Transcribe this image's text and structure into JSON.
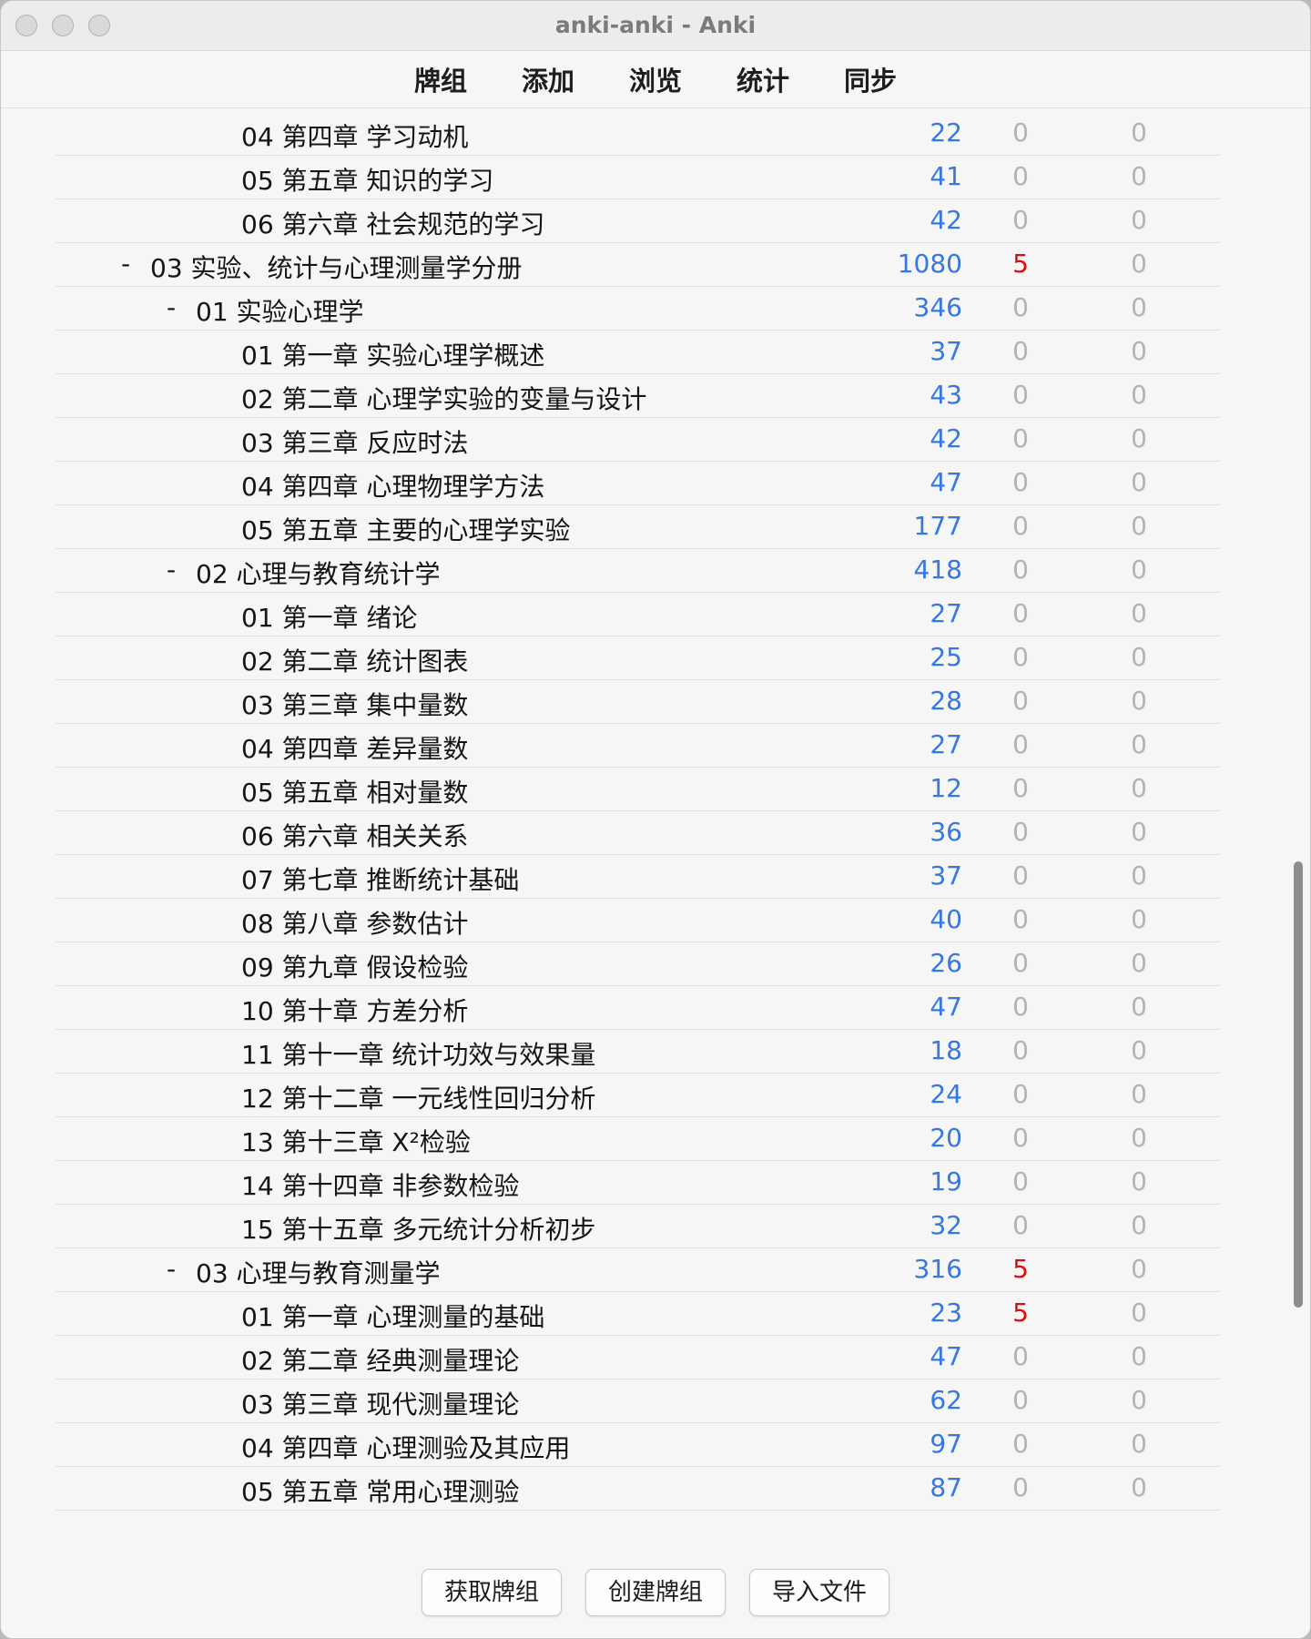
{
  "window": {
    "title": "anki-anki - Anki"
  },
  "toolbar": {
    "tabs": [
      "牌组",
      "添加",
      "浏览",
      "统计",
      "同步"
    ]
  },
  "decks": [
    {
      "level": 3,
      "collapse": "",
      "name": "04 第四章 学习动机",
      "new": "22",
      "learn": "0",
      "due": "0"
    },
    {
      "level": 3,
      "collapse": "",
      "name": "05 第五章 知识的学习",
      "new": "41",
      "learn": "0",
      "due": "0"
    },
    {
      "level": 3,
      "collapse": "",
      "name": "06 第六章 社会规范的学习",
      "new": "42",
      "learn": "0",
      "due": "0"
    },
    {
      "level": 1,
      "collapse": "-",
      "name": "03 实验、统计与心理测量学分册",
      "new": "1080",
      "learn": "5",
      "due": "0"
    },
    {
      "level": 2,
      "collapse": "-",
      "name": "01 实验心理学",
      "new": "346",
      "learn": "0",
      "due": "0"
    },
    {
      "level": 3,
      "collapse": "",
      "name": "01 第一章 实验心理学概述",
      "new": "37",
      "learn": "0",
      "due": "0"
    },
    {
      "level": 3,
      "collapse": "",
      "name": "02 第二章 心理学实验的变量与设计",
      "new": "43",
      "learn": "0",
      "due": "0"
    },
    {
      "level": 3,
      "collapse": "",
      "name": "03 第三章 反应时法",
      "new": "42",
      "learn": "0",
      "due": "0"
    },
    {
      "level": 3,
      "collapse": "",
      "name": "04 第四章 心理物理学方法",
      "new": "47",
      "learn": "0",
      "due": "0"
    },
    {
      "level": 3,
      "collapse": "",
      "name": "05 第五章 主要的心理学实验",
      "new": "177",
      "learn": "0",
      "due": "0"
    },
    {
      "level": 2,
      "collapse": "-",
      "name": "02 心理与教育统计学",
      "new": "418",
      "learn": "0",
      "due": "0"
    },
    {
      "level": 3,
      "collapse": "",
      "name": "01 第一章 绪论",
      "new": "27",
      "learn": "0",
      "due": "0"
    },
    {
      "level": 3,
      "collapse": "",
      "name": "02 第二章 统计图表",
      "new": "25",
      "learn": "0",
      "due": "0"
    },
    {
      "level": 3,
      "collapse": "",
      "name": "03 第三章 集中量数",
      "new": "28",
      "learn": "0",
      "due": "0"
    },
    {
      "level": 3,
      "collapse": "",
      "name": "04 第四章 差异量数",
      "new": "27",
      "learn": "0",
      "due": "0"
    },
    {
      "level": 3,
      "collapse": "",
      "name": "05 第五章 相对量数",
      "new": "12",
      "learn": "0",
      "due": "0"
    },
    {
      "level": 3,
      "collapse": "",
      "name": "06 第六章 相关关系",
      "new": "36",
      "learn": "0",
      "due": "0"
    },
    {
      "level": 3,
      "collapse": "",
      "name": "07 第七章 推断统计基础",
      "new": "37",
      "learn": "0",
      "due": "0"
    },
    {
      "level": 3,
      "collapse": "",
      "name": "08 第八章 参数估计",
      "new": "40",
      "learn": "0",
      "due": "0"
    },
    {
      "level": 3,
      "collapse": "",
      "name": "09 第九章 假设检验",
      "new": "26",
      "learn": "0",
      "due": "0"
    },
    {
      "level": 3,
      "collapse": "",
      "name": "10 第十章 方差分析",
      "new": "47",
      "learn": "0",
      "due": "0"
    },
    {
      "level": 3,
      "collapse": "",
      "name": "11 第十一章 统计功效与效果量",
      "new": "18",
      "learn": "0",
      "due": "0"
    },
    {
      "level": 3,
      "collapse": "",
      "name": "12 第十二章 一元线性回归分析",
      "new": "24",
      "learn": "0",
      "due": "0"
    },
    {
      "level": 3,
      "collapse": "",
      "name": "13 第十三章 X²检验",
      "new": "20",
      "learn": "0",
      "due": "0"
    },
    {
      "level": 3,
      "collapse": "",
      "name": "14 第十四章 非参数检验",
      "new": "19",
      "learn": "0",
      "due": "0"
    },
    {
      "level": 3,
      "collapse": "",
      "name": "15 第十五章 多元统计分析初步",
      "new": "32",
      "learn": "0",
      "due": "0"
    },
    {
      "level": 2,
      "collapse": "-",
      "name": "03 心理与教育测量学",
      "new": "316",
      "learn": "5",
      "due": "0"
    },
    {
      "level": 3,
      "collapse": "",
      "name": "01 第一章 心理测量的基础",
      "new": "23",
      "learn": "5",
      "due": "0"
    },
    {
      "level": 3,
      "collapse": "",
      "name": "02 第二章 经典测量理论",
      "new": "47",
      "learn": "0",
      "due": "0"
    },
    {
      "level": 3,
      "collapse": "",
      "name": "03 第三章 现代测量理论",
      "new": "62",
      "learn": "0",
      "due": "0"
    },
    {
      "level": 3,
      "collapse": "",
      "name": "04 第四章 心理测验及其应用",
      "new": "97",
      "learn": "0",
      "due": "0"
    },
    {
      "level": 3,
      "collapse": "",
      "name": "05 第五章 常用心理测验",
      "new": "87",
      "learn": "0",
      "due": "0"
    }
  ],
  "bottom_buttons": {
    "get_shared": "获取牌组",
    "create_deck": "创建牌组",
    "import_file": "导入文件"
  },
  "colors": {
    "new_count": "#3478e5",
    "learn_nonzero": "#d60f0f",
    "zero_count": "#b3b3b3"
  }
}
